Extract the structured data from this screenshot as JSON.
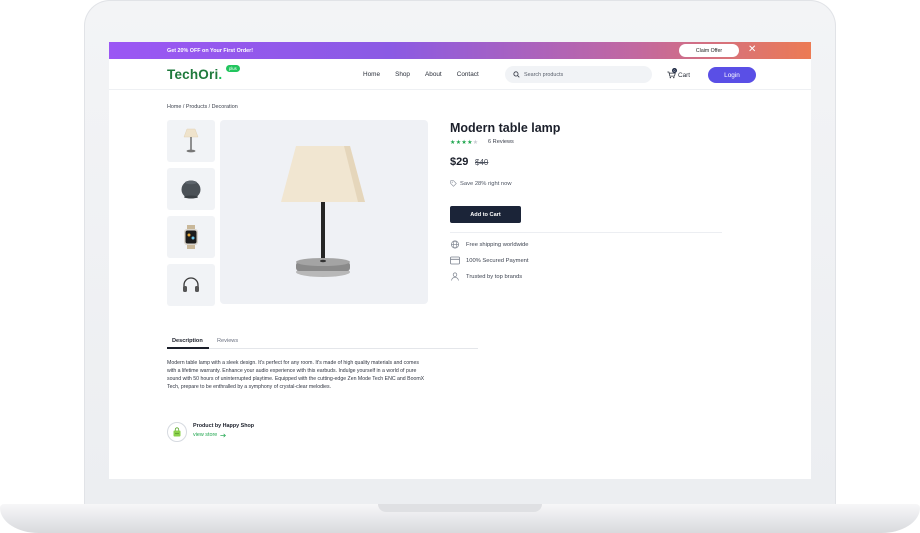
{
  "promo": {
    "text": "Get 20% OFF on Your First Order!",
    "claim_label": "Claim Offer",
    "close_glyph": "✕",
    "gradient": [
      "#9b57f4",
      "#ec7b54"
    ]
  },
  "nav": {
    "logo_text": "TechOri",
    "logo_dot": ".",
    "logo_badge": "plus",
    "links": [
      "Home",
      "Shop",
      "About",
      "Contact"
    ],
    "search_placeholder": "Search products",
    "cart_label": "Cart",
    "cart_count": "0",
    "login_label": "Login"
  },
  "breadcrumb": "Home / Products / Decoration",
  "gallery": {
    "thumbnails": [
      "lamp-icon",
      "speaker-icon",
      "smartwatch-icon",
      "headphones-icon"
    ]
  },
  "product": {
    "title": "Modern table lamp",
    "rating": 4,
    "rating_max": 5,
    "reviews_label": "6 Reviews",
    "price": "$29",
    "old_price": "$40",
    "save_text": "Save 28% right now",
    "add_to_cart_label": "Add to Cart",
    "features": [
      {
        "icon": "globe-icon",
        "text": "Free shipping worldwide"
      },
      {
        "icon": "card-icon",
        "text": "100% Secured Payment"
      },
      {
        "icon": "user-icon",
        "text": "Trusted by top brands"
      }
    ]
  },
  "tabs": {
    "active": "Description",
    "other": "Reviews"
  },
  "description": "Modern table lamp with a sleek design. It's perfect for any room. It's made of high  quality materials and comes with a lifetime warranty. Enhance your audio experience with this earbuds. Indulge yourself in a world of pure sound with 50 hours of uninterrupted playtime. Equipped with the cutting-edge Zen Mode Tech ENC and BoomX Tech, prepare to be enthralled by a symphony of crystal-clear melodies.",
  "seller": {
    "name_label": "Product by Happy Shop",
    "link_label": "view store"
  },
  "colors": {
    "brand_green": "#1fa64e",
    "login_purple": "#5a4fe6",
    "dark_button": "#1b2438"
  }
}
